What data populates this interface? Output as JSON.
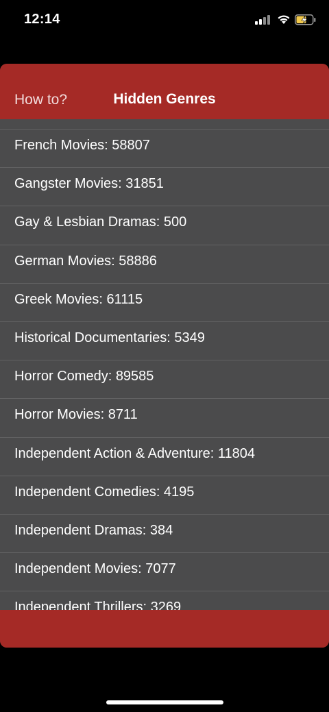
{
  "status_bar": {
    "time": "12:14"
  },
  "nav": {
    "left_label": "How to?",
    "title": "Hidden Genres"
  },
  "genres": [
    {
      "label": "French Movies: 58807"
    },
    {
      "label": "Gangster Movies: 31851"
    },
    {
      "label": "Gay & Lesbian Dramas: 500"
    },
    {
      "label": "German Movies: 58886"
    },
    {
      "label": "Greek Movies: 61115"
    },
    {
      "label": "Historical Documentaries: 5349"
    },
    {
      "label": "Horror Comedy: 89585"
    },
    {
      "label": "Horror Movies: 8711"
    },
    {
      "label": "Independent Action & Adventure: 11804"
    },
    {
      "label": "Independent Comedies: 4195"
    },
    {
      "label": "Independent Dramas: 384"
    },
    {
      "label": "Independent Movies: 7077"
    },
    {
      "label": "Independent Thrillers: 3269"
    }
  ],
  "colors": {
    "accent": "#a52a26",
    "list_background": "#4b4b4c",
    "separator": "#626263",
    "screen_background": "#000000"
  },
  "icons": [
    "signal-icon",
    "wifi-icon",
    "battery-charging-icon"
  ]
}
